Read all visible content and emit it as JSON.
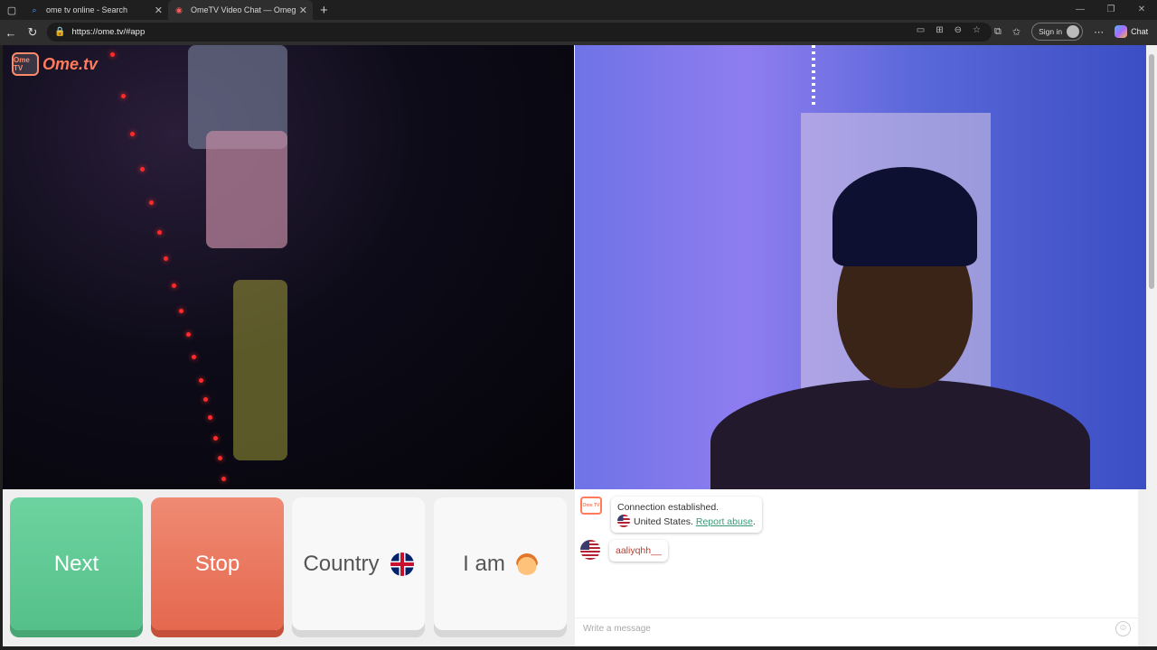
{
  "browser": {
    "tabs": [
      {
        "title": "ome tv online - Search",
        "icon": "search-icon",
        "active": false
      },
      {
        "title": "OmeTV Video Chat — Omegle",
        "icon": "record-icon",
        "active": true
      }
    ],
    "url": "https://ome.tv/#app",
    "signin_label": "Sign in",
    "chat_label": "Chat"
  },
  "app": {
    "logo_text": "Ome.tv",
    "logo_badge": "Ome TV",
    "buttons": {
      "next": "Next",
      "stop": "Stop",
      "country": "Country",
      "iam": "I am"
    },
    "colors": {
      "next": "#5ec793",
      "stop": "#e9725a",
      "accent": "#ff7b5a",
      "link": "#3a9a77"
    }
  },
  "chat": {
    "system": {
      "line1": "Connection established.",
      "country": "United States.",
      "report": "Report abuse",
      "period": "."
    },
    "messages": [
      {
        "flag": "us-flag-icon",
        "text": "aaliyqhh__"
      }
    ],
    "input_placeholder": "Write a message"
  }
}
